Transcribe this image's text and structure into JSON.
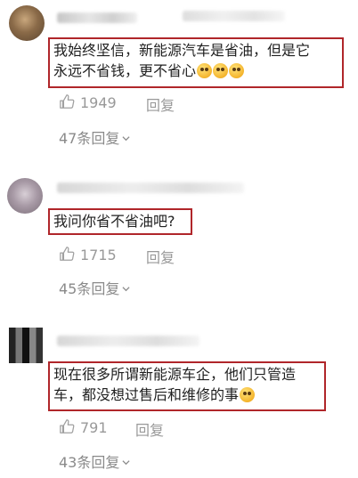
{
  "comments": [
    {
      "text_line1": "我始终坚信，新能源汽车是省油，但是它",
      "text_line2": "永远不省钱，更不省心",
      "emojis": [
        "facepalm-emoji",
        "facepalm-emoji",
        "facepalm-emoji"
      ],
      "likes": "1949",
      "reply_label": "回复",
      "more_replies": "47条回复"
    },
    {
      "text_line1": "我问你省不省油吧?",
      "likes": "1715",
      "reply_label": "回复",
      "more_replies": "45条回复"
    },
    {
      "text_line1": "现在很多所谓新能源车企，他们只管造",
      "text_line2": "车，都没想过售后和维修的事",
      "emojis": [
        "smirk-emoji"
      ],
      "likes": "791",
      "reply_label": "回复",
      "more_replies": "43条回复"
    }
  ],
  "colors": {
    "highlight_border": "#b0262a",
    "secondary_text": "#999999"
  },
  "icons": {
    "like": "thumbs-up-icon",
    "expand": "chevron-down-icon"
  }
}
